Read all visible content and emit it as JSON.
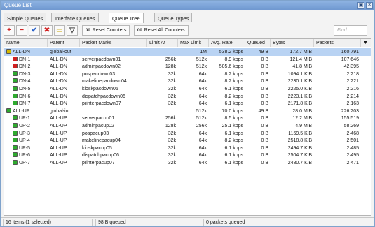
{
  "window": {
    "title": "Queue List",
    "btn_restore": "▣",
    "btn_close": "✕"
  },
  "tabs": [
    {
      "label": "Simple Queues",
      "active": false
    },
    {
      "label": "Interface Queues",
      "active": false
    },
    {
      "label": "Queue Tree",
      "active": true
    },
    {
      "label": "Queue Types",
      "active": false
    }
  ],
  "toolbar": {
    "add": "+",
    "remove": "−",
    "enable": "✔",
    "disable": "✖",
    "comment": "▭",
    "filter": "▽",
    "reset_counters": "Reset Counters",
    "reset_all_counters": "Reset All Counters",
    "reset_glyph": "00",
    "find_placeholder": "Find"
  },
  "columns": [
    "Name",
    "Parent",
    "Packet Marks",
    "Limit At",
    "Max Limit",
    "Avg. Rate",
    "Queued",
    "Bytes",
    "Packets"
  ],
  "colors": {
    "parent_icon": "#d4b800",
    "active_icon": "#2eaa2e",
    "red_icon": "#d02020",
    "selected_row": "#b9d3f3",
    "titlebar": "#7aa2d6"
  },
  "rows": [
    {
      "name": "ALL-DN",
      "parent": "global-out",
      "marks": "",
      "limit_at": "",
      "max_limit": "1M",
      "avg_rate": "538.2 kbps",
      "queued": "49 B",
      "bytes": "172.7 MiB",
      "packets": "160 791",
      "icon": "parent",
      "indent": 0,
      "selected": true
    },
    {
      "name": "DN-1",
      "parent": "ALL-DN",
      "marks": "serverpacdown01",
      "limit_at": "256k",
      "max_limit": "512k",
      "avg_rate": "8.9 kbps",
      "queued": "0 B",
      "bytes": "121.4 MiB",
      "packets": "107 646",
      "icon": "red",
      "indent": 1,
      "selected": false
    },
    {
      "name": "DN-2",
      "parent": "ALL-DN",
      "marks": "adminpacdown02",
      "limit_at": "128k",
      "max_limit": "512k",
      "avg_rate": "505.6 kbps",
      "queued": "0 B",
      "bytes": "41.8 MiB",
      "packets": "42 395",
      "icon": "red",
      "indent": 1,
      "selected": false
    },
    {
      "name": "DN-3",
      "parent": "ALL-DN",
      "marks": "pospacdown03",
      "limit_at": "32k",
      "max_limit": "64k",
      "avg_rate": "8.2 kbps",
      "queued": "0 B",
      "bytes": "1094.1 KiB",
      "packets": "2 218",
      "icon": "active",
      "indent": 1,
      "selected": false
    },
    {
      "name": "DN-4",
      "parent": "ALL-DN",
      "marks": "makelinepacdown04",
      "limit_at": "32k",
      "max_limit": "64k",
      "avg_rate": "8.2 kbps",
      "queued": "0 B",
      "bytes": "2230.1 KiB",
      "packets": "2 221",
      "icon": "active",
      "indent": 1,
      "selected": false
    },
    {
      "name": "DN-5",
      "parent": "ALL-DN",
      "marks": "kioskpacdown05",
      "limit_at": "32k",
      "max_limit": "64k",
      "avg_rate": "6.1 kbps",
      "queued": "0 B",
      "bytes": "2225.0 KiB",
      "packets": "2 216",
      "icon": "active",
      "indent": 1,
      "selected": false
    },
    {
      "name": "DN-6",
      "parent": "ALL-DN",
      "marks": "dispatchpacdown06",
      "limit_at": "32k",
      "max_limit": "64k",
      "avg_rate": "8.2 kbps",
      "queued": "0 B",
      "bytes": "2223.1 KiB",
      "packets": "2 214",
      "icon": "active",
      "indent": 1,
      "selected": false
    },
    {
      "name": "DN-7",
      "parent": "ALL-DN",
      "marks": "printerpacdown07",
      "limit_at": "32k",
      "max_limit": "64k",
      "avg_rate": "6.1 kbps",
      "queued": "0 B",
      "bytes": "2171.8 KiB",
      "packets": "2 163",
      "icon": "active",
      "indent": 1,
      "selected": false
    },
    {
      "name": "ALL-UP",
      "parent": "global-in",
      "marks": "",
      "limit_at": "",
      "max_limit": "512k",
      "avg_rate": "70.0 kbps",
      "queued": "49 B",
      "bytes": "28.0 MiB",
      "packets": "226 203",
      "icon": "active",
      "indent": 0,
      "selected": false
    },
    {
      "name": "UP-1",
      "parent": "ALL-UP",
      "marks": "serverpacup01",
      "limit_at": "256k",
      "max_limit": "512k",
      "avg_rate": "8.5 kbps",
      "queued": "0 B",
      "bytes": "12.2 MiB",
      "packets": "155 519",
      "icon": "active",
      "indent": 1,
      "selected": false
    },
    {
      "name": "UP-2",
      "parent": "ALL-UP",
      "marks": "adminpacup02",
      "limit_at": "128k",
      "max_limit": "256k",
      "avg_rate": "25.1 kbps",
      "queued": "0 B",
      "bytes": "4.9 MiB",
      "packets": "58 269",
      "icon": "active",
      "indent": 1,
      "selected": false
    },
    {
      "name": "UP-3",
      "parent": "ALL-UP",
      "marks": "pospacup03",
      "limit_at": "32k",
      "max_limit": "64k",
      "avg_rate": "6.1 kbps",
      "queued": "0 B",
      "bytes": "1169.5 KiB",
      "packets": "2 468",
      "icon": "active",
      "indent": 1,
      "selected": false
    },
    {
      "name": "UP-4",
      "parent": "ALL-UP",
      "marks": "makelinepacup04",
      "limit_at": "32k",
      "max_limit": "64k",
      "avg_rate": "8.2 kbps",
      "queued": "0 B",
      "bytes": "2518.8 KiB",
      "packets": "2 501",
      "icon": "active",
      "indent": 1,
      "selected": false
    },
    {
      "name": "UP-5",
      "parent": "ALL-UP",
      "marks": "kioskpacup05",
      "limit_at": "32k",
      "max_limit": "64k",
      "avg_rate": "6.1 kbps",
      "queued": "0 B",
      "bytes": "2494.7 KiB",
      "packets": "2 485",
      "icon": "active",
      "indent": 1,
      "selected": false
    },
    {
      "name": "UP-6",
      "parent": "ALL-UP",
      "marks": "dispatchpacup06",
      "limit_at": "32k",
      "max_limit": "64k",
      "avg_rate": "6.1 kbps",
      "queued": "0 B",
      "bytes": "2504.7 KiB",
      "packets": "2 495",
      "icon": "active",
      "indent": 1,
      "selected": false
    },
    {
      "name": "UP-7",
      "parent": "ALL-UP",
      "marks": "printerpacup07",
      "limit_at": "32k",
      "max_limit": "64k",
      "avg_rate": "6.1 kbps",
      "queued": "0 B",
      "bytes": "2480.7 KiB",
      "packets": "2 471",
      "icon": "active",
      "indent": 1,
      "selected": false
    }
  ],
  "status": {
    "items": "16 items (1 selected)",
    "queued": "98 B queued",
    "packets_queued": "0 packets queued"
  }
}
